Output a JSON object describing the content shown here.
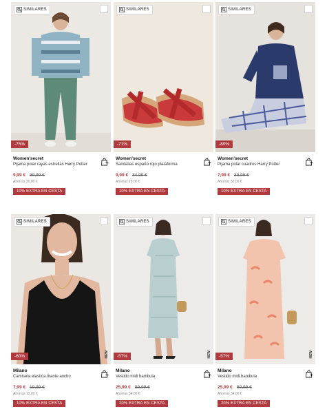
{
  "common": {
    "similar_label": "SIMILARES",
    "bag_icon": "bag-plus-icon",
    "search_icon": "search-icon",
    "accent_color": "#b03a3e"
  },
  "products": [
    {
      "brand": "Women'secret",
      "name": "Pijama polar rayas estrellas Harry Potter",
      "price": "9,99 €",
      "old_price": "39,99 €",
      "savings": "Ahorras 30,00 €",
      "discount": "-75%",
      "promo": "10% EXTRA EN CESTA",
      "side_tag": ""
    },
    {
      "brand": "Women'secret",
      "name": "Sandalias esparto rojo plataforma",
      "price": "9,99 €",
      "old_price": "34,99 €",
      "savings": "Ahorras 25,00 €",
      "discount": "-71%",
      "promo": "10% EXTRA EN CESTA",
      "side_tag": ""
    },
    {
      "brand": "Women'secret",
      "name": "Pijama polar cuadros Harry Potter",
      "price": "7,99 €",
      "old_price": "39,99 €",
      "savings": "Ahorras 32,00 €",
      "discount": "-80%",
      "promo": "10% EXTRA EN CESTA",
      "side_tag": ""
    },
    {
      "brand": "Milano",
      "name": "Camiseta elastica tirante ancho",
      "price": "7,99 €",
      "old_price": "19,99 €",
      "savings": "Ahorras 12,00 €",
      "discount": "-60%",
      "promo": "10% EXTRA EN CESTA",
      "side_tag": "NEW"
    },
    {
      "brand": "Milano",
      "name": "Vestido midi bambula",
      "price": "25,99 €",
      "old_price": "59,99 €",
      "savings": "Ahorras 34,00 €",
      "discount": "-57%",
      "promo": "20% EXTRA EN CESTA",
      "side_tag": "NEW"
    },
    {
      "brand": "Milano",
      "name": "Vestido midi bambula",
      "price": "25,99 €",
      "old_price": "59,99 €",
      "savings": "Ahorras 34,00 €",
      "discount": "-57%",
      "promo": "20% EXTRA EN CESTA",
      "side_tag": "NEW"
    }
  ]
}
